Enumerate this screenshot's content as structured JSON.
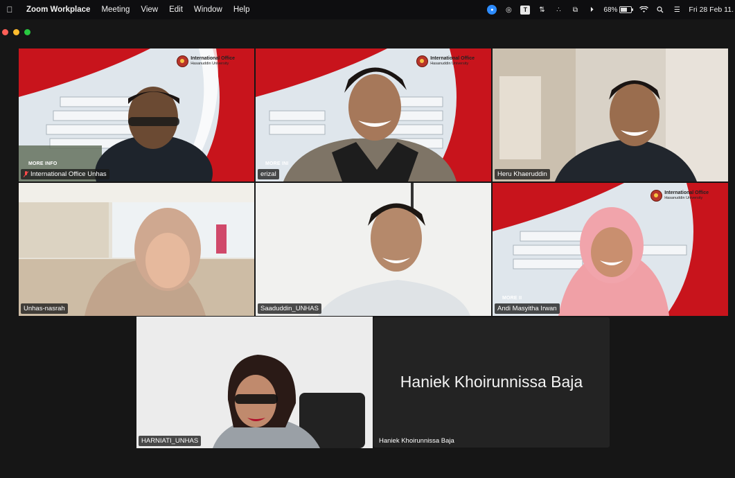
{
  "menubar": {
    "app_name": "Zoom Workplace",
    "menus": [
      "Meeting",
      "View",
      "Edit",
      "Window",
      "Help"
    ],
    "battery": "68%",
    "clock": "Fri 28 Feb  11."
  },
  "window_controls": {
    "colors": {
      "close": "#ff5f57",
      "minimize": "#febc2e",
      "zoom": "#28c840"
    }
  },
  "branding": {
    "office_name": "International Office",
    "university": "Hasanuddin University",
    "more_info": "MORE INFO",
    "more_info_cut": "MORE INI",
    "more_info_cut2": "MORE II"
  },
  "participants": [
    {
      "name": "International Office Unhas",
      "muted": true
    },
    {
      "name": "erizal"
    },
    {
      "name": "Heru  Khaeruddin"
    },
    {
      "name": "Unhas-nasrah"
    },
    {
      "name": "Saaduddin_UNHAS"
    },
    {
      "name": "Andi Masyitha Irwan"
    },
    {
      "name": "HARNIATI_UNHAS",
      "active_speaker": true
    },
    {
      "name": "Haniek Khoirunnissa Baja",
      "video_off": true
    }
  ],
  "colors": {
    "active_speaker_border": "#21c45a",
    "brand_red": "#c8141c"
  }
}
